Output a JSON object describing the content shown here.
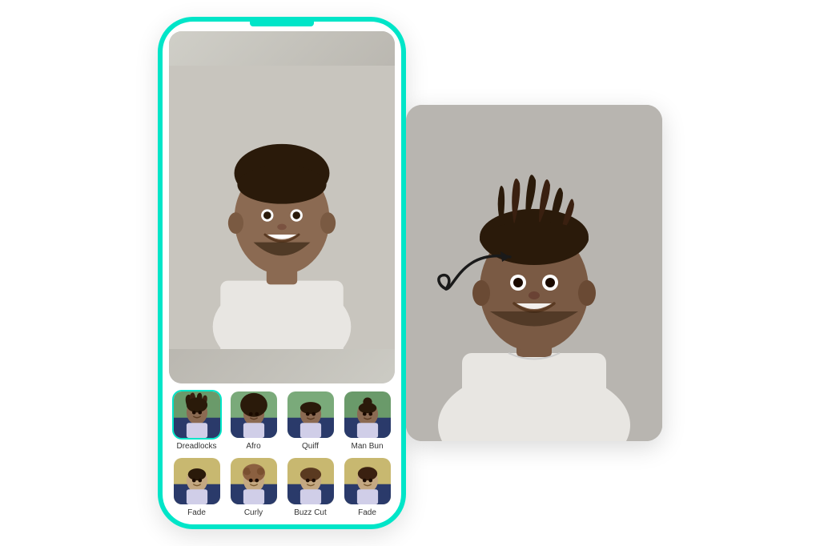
{
  "scene": {
    "background": "#ffffff"
  },
  "phone": {
    "main_photo_alt": "Man with short hair, white t-shirt, gray background",
    "hair_styles": [
      {
        "id": "dreadlocks",
        "label": "Dreadlocks",
        "selected": true,
        "bg_class": "thumb-bg-1"
      },
      {
        "id": "afro",
        "label": "Afro",
        "selected": false,
        "bg_class": "thumb-bg-2"
      },
      {
        "id": "quiff",
        "label": "Quiff",
        "selected": false,
        "bg_class": "thumb-bg-3"
      },
      {
        "id": "man-bun",
        "label": "Man Bun",
        "selected": false,
        "bg_class": "thumb-bg-4"
      },
      {
        "id": "fade",
        "label": "Fade",
        "selected": false,
        "bg_class": "thumb-bg-5"
      },
      {
        "id": "curly",
        "label": "Curly",
        "selected": false,
        "bg_class": "thumb-bg-6"
      },
      {
        "id": "buzz-cut",
        "label": "Buzz Cut",
        "selected": false,
        "bg_class": "thumb-bg-7"
      },
      {
        "id": "fade2",
        "label": "Fade",
        "selected": false,
        "bg_class": "thumb-bg-8"
      }
    ]
  },
  "result": {
    "alt": "Man with dreadlocks hairstyle applied, white t-shirt, gray background"
  },
  "arrow": {
    "description": "Curved arrow pointing from phone to result photo"
  }
}
